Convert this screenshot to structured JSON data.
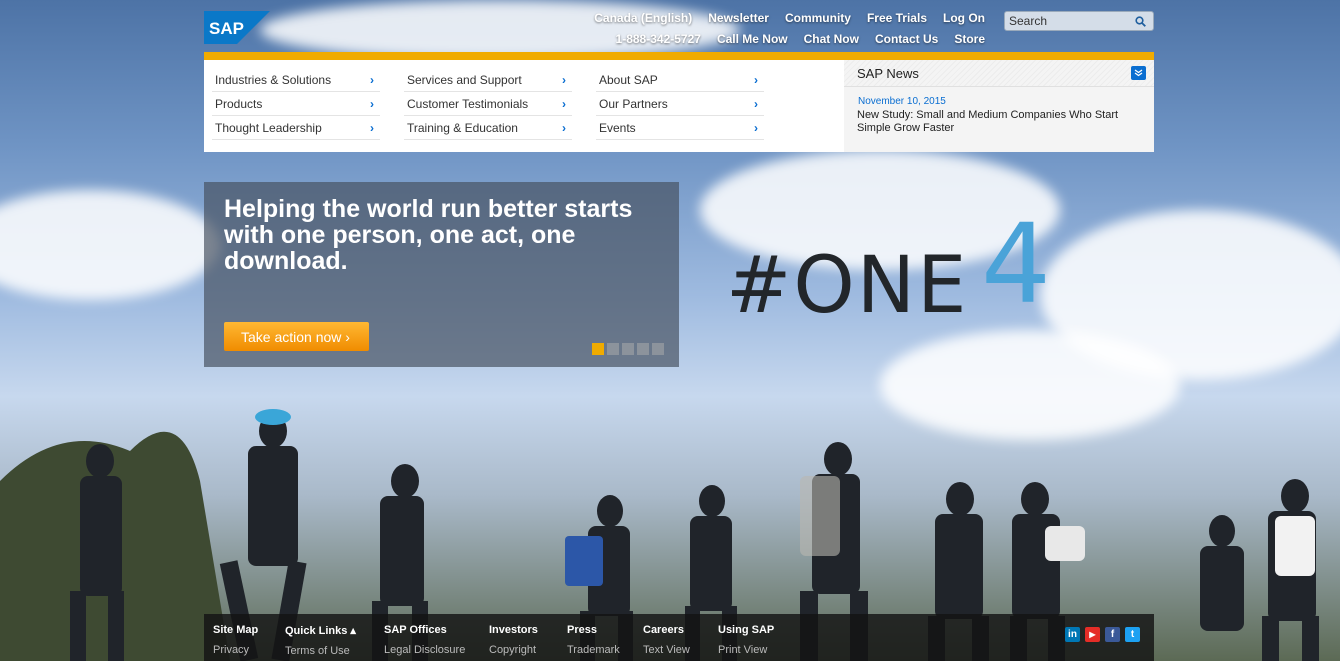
{
  "brand": {
    "logo_text": "SAP",
    "accent": "#f0ab00",
    "link_blue": "#0a6ed1"
  },
  "utility_nav": {
    "row1": [
      "Canada (English)",
      "Newsletter",
      "Community",
      "Free Trials",
      "Log On"
    ],
    "row2": [
      "1-888-342-5727",
      "Call Me Now",
      "Chat Now",
      "Contact Us",
      "Store"
    ]
  },
  "search": {
    "placeholder": "Search"
  },
  "menu": {
    "col1": [
      "Industries & Solutions",
      "Products",
      "Thought Leadership"
    ],
    "col2": [
      "Services and Support",
      "Customer Testimonials",
      "Training & Education"
    ],
    "col3": [
      "About SAP",
      "Our Partners",
      "Events"
    ]
  },
  "news": {
    "title": "SAP News",
    "date": "November 10, 2015",
    "headline": "New Study: Small and Medium Companies Who Start Simple Grow Faster"
  },
  "hero": {
    "headline": "Helping the world run better starts with one person, one act, one download.",
    "cta_label": "Take action now ›",
    "hashtag": "#ONE",
    "hashtag_digit": "4",
    "slide_count": 5,
    "active_slide": 1
  },
  "footer": {
    "columns": [
      {
        "head": "Site Map",
        "sub": "Privacy"
      },
      {
        "head": "Quick Links ▴",
        "sub": "Terms of Use"
      },
      {
        "head": "SAP Offices",
        "sub": "Legal Disclosure"
      },
      {
        "head": "Investors",
        "sub": "Copyright"
      },
      {
        "head": "Press",
        "sub": "Trademark"
      },
      {
        "head": "Careers",
        "sub": "Text View"
      },
      {
        "head": "Using SAP",
        "sub": "Print View"
      }
    ],
    "social_icons": [
      "linkedin-icon",
      "youtube-icon",
      "facebook-icon",
      "twitter-icon"
    ]
  }
}
